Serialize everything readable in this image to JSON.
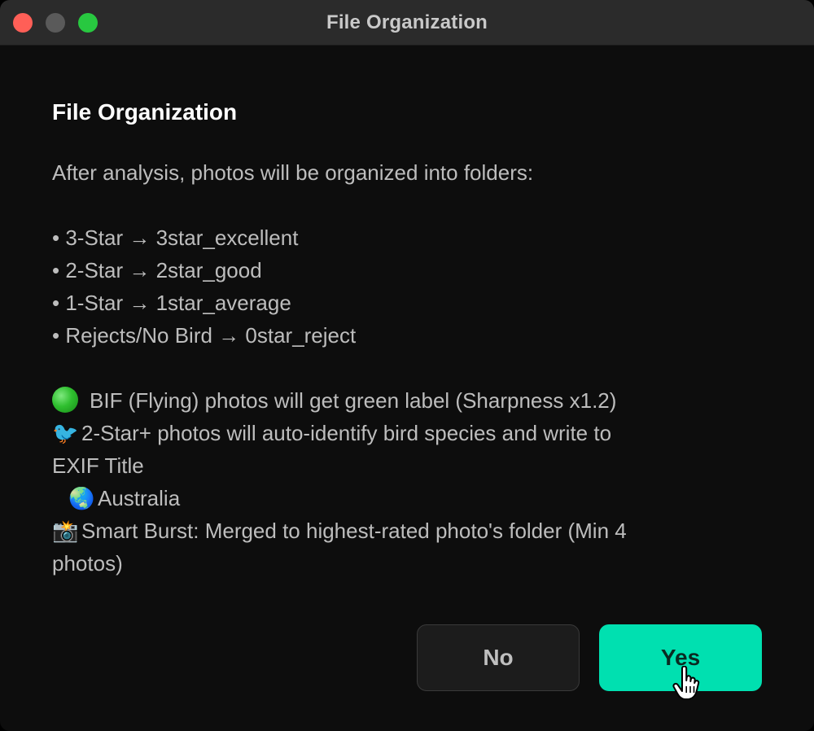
{
  "window": {
    "title": "File Organization",
    "controls": {
      "close_color": "#ff5f57",
      "minimize_color": "#5a5a5a",
      "zoom_color": "#28c840"
    }
  },
  "dialog": {
    "heading": "File Organization",
    "intro": "After analysis, photos will be organized into folders:",
    "folder_rules": [
      "• 3-Star → 3star_excellent",
      "• 2-Star → 2star_good",
      "• 1-Star → 1star_average",
      "• Rejects/No Bird → 0star_reject"
    ],
    "bif_note": "BIF (Flying) photos will get green label (Sharpness x1.2)",
    "bird_id_note_line1": "2-Star+ photos will auto-identify bird species and write to",
    "bird_id_note_line2": "EXIF Title",
    "region": "Australia",
    "burst_note_line1": "Smart Burst: Merged to highest-rated photo's folder (Min 4",
    "burst_note_line2": "photos)",
    "icons": {
      "bif": "green-circle-icon",
      "bird": "bird-icon",
      "region": "globe-icon",
      "burst": "camera-flash-icon"
    },
    "glyphs": {
      "bird": "🐦",
      "globe": "🌏",
      "camera": "📸"
    }
  },
  "buttons": {
    "no_label": "No",
    "yes_label": "Yes",
    "accent_color": "#00e0b0"
  }
}
